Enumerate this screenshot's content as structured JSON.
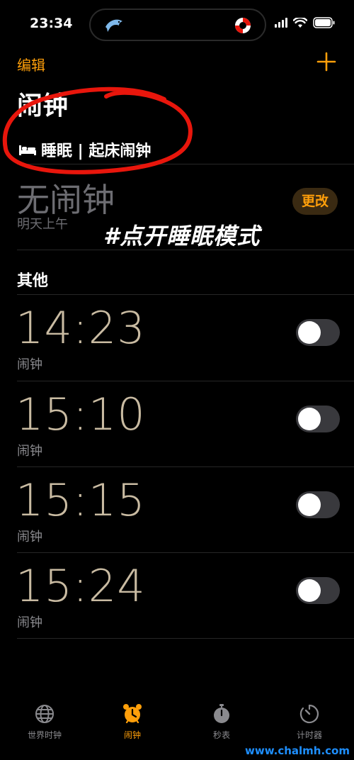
{
  "status": {
    "time": "23:34"
  },
  "header": {
    "edit_label": "编辑",
    "title": "闹钟"
  },
  "sleep": {
    "header_label": "睡眠 | 起床闹钟",
    "no_alarm": "无闹钟",
    "sub": "明天上午",
    "change_label": "更改"
  },
  "annotation": {
    "caption": "#点开睡眠模式"
  },
  "others": {
    "section_label": "其他",
    "alarms": [
      {
        "time": "14:23",
        "label": "闹钟",
        "enabled": false
      },
      {
        "time": "15:10",
        "label": "闹钟",
        "enabled": false
      },
      {
        "time": "15:15",
        "label": "闹钟",
        "enabled": false
      },
      {
        "time": "15:24",
        "label": "闹钟",
        "enabled": false
      }
    ]
  },
  "tabs": [
    {
      "label": "世界时钟",
      "icon": "globe-icon",
      "active": false
    },
    {
      "label": "闹钟",
      "icon": "alarm-clock-icon",
      "active": true
    },
    {
      "label": "秒表",
      "icon": "stopwatch-icon",
      "active": false
    },
    {
      "label": "计时器",
      "icon": "timer-icon",
      "active": false
    }
  ],
  "watermark": "www.chalmh.com",
  "colors": {
    "accent": "#ff9f0a",
    "background": "#000000",
    "alarm_time": "#c9bba2",
    "annotation_circle": "#e8160c"
  }
}
